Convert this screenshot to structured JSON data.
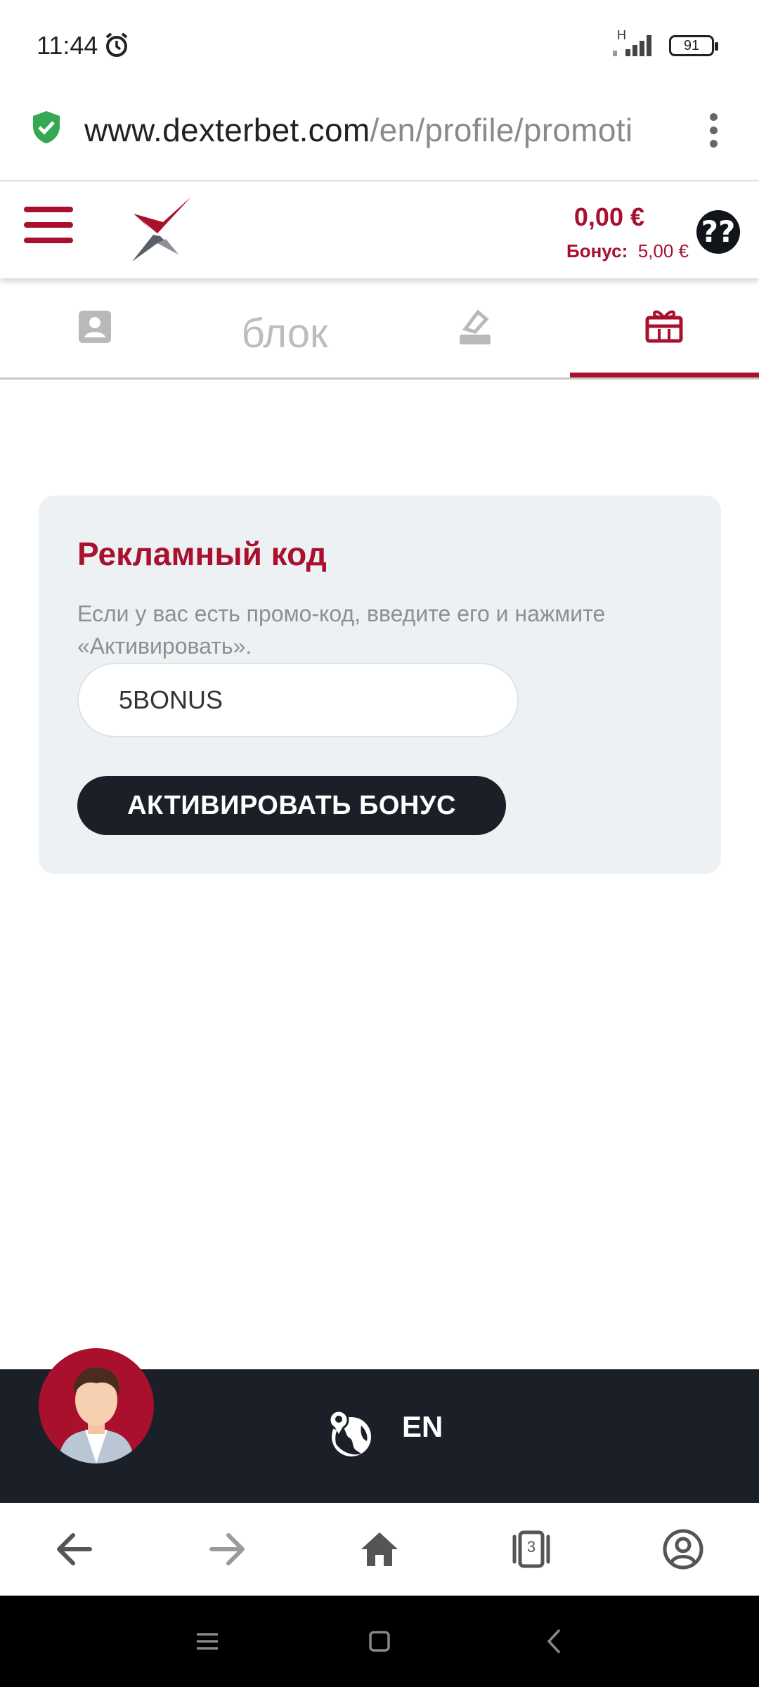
{
  "status_bar": {
    "time": "11:44",
    "network": "H",
    "battery": "91"
  },
  "browser": {
    "url_domain": "www.dexterbet.com",
    "url_path": "/en/profile/promoti",
    "tab_count": "3"
  },
  "header": {
    "balance": "0,00 €",
    "bonus_label": "Бонус:",
    "bonus_value": "5,00 €",
    "brand_color": "#a8102e"
  },
  "tabs": [
    {
      "name": "profile",
      "icon": "user-card-icon",
      "label": ""
    },
    {
      "name": "block",
      "icon": "",
      "label": "блок"
    },
    {
      "name": "bets",
      "icon": "bet-slip-icon",
      "label": ""
    },
    {
      "name": "promotions",
      "icon": "gift-icon",
      "label": "",
      "active": true
    }
  ],
  "promo": {
    "title": "Рекламный код",
    "description": "Если у вас есть промо-код, введите его и нажмите «Активировать».",
    "code_value": "5BONUS",
    "button_label": "АКТИВИРОВАТЬ БОНУС"
  },
  "footer": {
    "language": "EN"
  }
}
